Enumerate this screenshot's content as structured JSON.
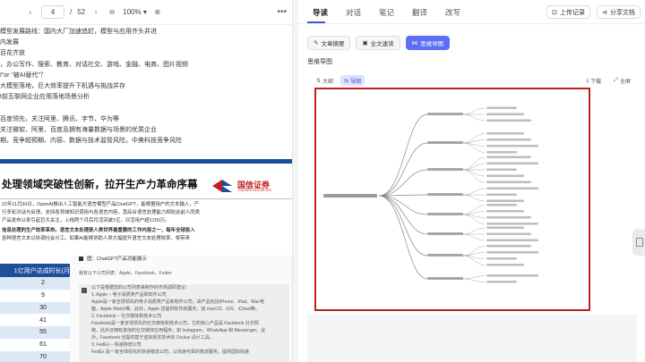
{
  "viewer": {
    "prev_icon": "‹",
    "next_icon": "›",
    "page": "4",
    "page_sep": "/",
    "total_pages": "52",
    "zoom_out_icon": "⊖",
    "zoom": "100%",
    "zoom_caret": "▾",
    "zoom_in_icon": "⊕",
    "more_icon": "•••"
  },
  "outline": [
    "模型发展路线：国内大厂加速追赶，模型与应用齐头并进",
    "内发展",
    "百花齐放",
    "，办公写作、搜索、教育、对话社交、游戏、金融、电商、图片视频",
    "I”or “被AI替代”？",
    "大模型落地，巨大效率提升下机遇与挑战并存",
    "t前互联网企业应用落地场景分析",
    "",
    "百度领先，关注阿里、腾讯、字节、华为等",
    "关注微软、阿里、百度及拥有海量数据与场景的优质企业",
    "期，竞争超预期、内容、数据与技术监管风险，中美科技竞争风险"
  ],
  "doc": {
    "title": "处理领域突破性创新，拉开生产力革命序幕",
    "logo_text": "国信证券",
    "logo_sub": "GUOSEN SECURITIES",
    "para1": [
      "22年11月30日，OpenAI推出人工智能大语言模型产品ChatGPT，能根据用户的文本输入，产",
      "行多轮对话与反馈，支持各领域知识调用与各语言内容。其综合语言处理能力相较此前人同类",
      "产品发布以来引起巨大关注，上线两个月后月活突破1亿，日活用户超1200万。"
    ],
    "para2": [
      "信息处理的生产效率革命。语言文本处理是人类世界最重要的工作内容之一，每年全球投入",
      "各种语言文本以协调社会分工。如果AI能够协助人类大幅提升语言文本处理效率，将带来"
    ],
    "table": {
      "header": "1亿用户达成时长(月)",
      "rows": [
        "2",
        "9",
        "30",
        "41",
        "55",
        "61",
        "70"
      ]
    },
    "chat": {
      "header": "图：ChatGPT产品功能展示",
      "msg1": "我有以下公司列表：Apple、Facebook、Fedex",
      "block": [
        "以下是根据您的公司列表来制作的市场调研建议：",
        "",
        "1. Apple – 电子消费类产品和软件公司",
        "Apple是一家全球领先的电子消费类产品和软件公司，由产品包括iPhone、iPad、Mac电",
        "脑、Apple Watch等。此外，Apple 还提供软件和服务，如 macOS、iOS、iCloud等。",
        "2. Facebook – 社交媒体和技术公司",
        "Facebook是一家全球领先的社交媒体和技术公司，它的核心产品是 Facebook 社交网",
        "络，此外还拥有其他的社交媒体应用程序，如 Instagram、WhatsApp 和 Messenger。此",
        "外，Facebook 也提供基于虚拟现实技术的 Oculus 设计工具。",
        "3. FedEx – 快递物流公司",
        "FedEx 是一家全球领先的快递物流公司，以快速可靠的物流服务，提供国际快递"
      ]
    }
  },
  "panel": {
    "tabs": [
      "导读",
      "对话",
      "笔记",
      "翻译",
      "改写"
    ],
    "upload_icon": "⊡",
    "upload_label": "上传记录",
    "share_icon": "⊲",
    "share_label": "分享文档",
    "subtabs": [
      {
        "icon": "✎",
        "label": "文章摘要"
      },
      {
        "icon": "▣",
        "label": "全文速读"
      },
      {
        "icon": "⋈",
        "label": "思维导图"
      }
    ],
    "section_title": "思维导图",
    "chips": [
      {
        "icon": "⇅",
        "label": "大纲"
      },
      {
        "icon": "⇆",
        "label": "导图"
      }
    ],
    "download_icon": "⤓",
    "download_label": "下载",
    "fullscreen_icon": "⤢",
    "fullscreen_label": "全屏"
  },
  "colors": {
    "accent": "#5c6ef5",
    "highlight_border": "#c01f1f",
    "doc_blue": "#1d4f9b"
  }
}
